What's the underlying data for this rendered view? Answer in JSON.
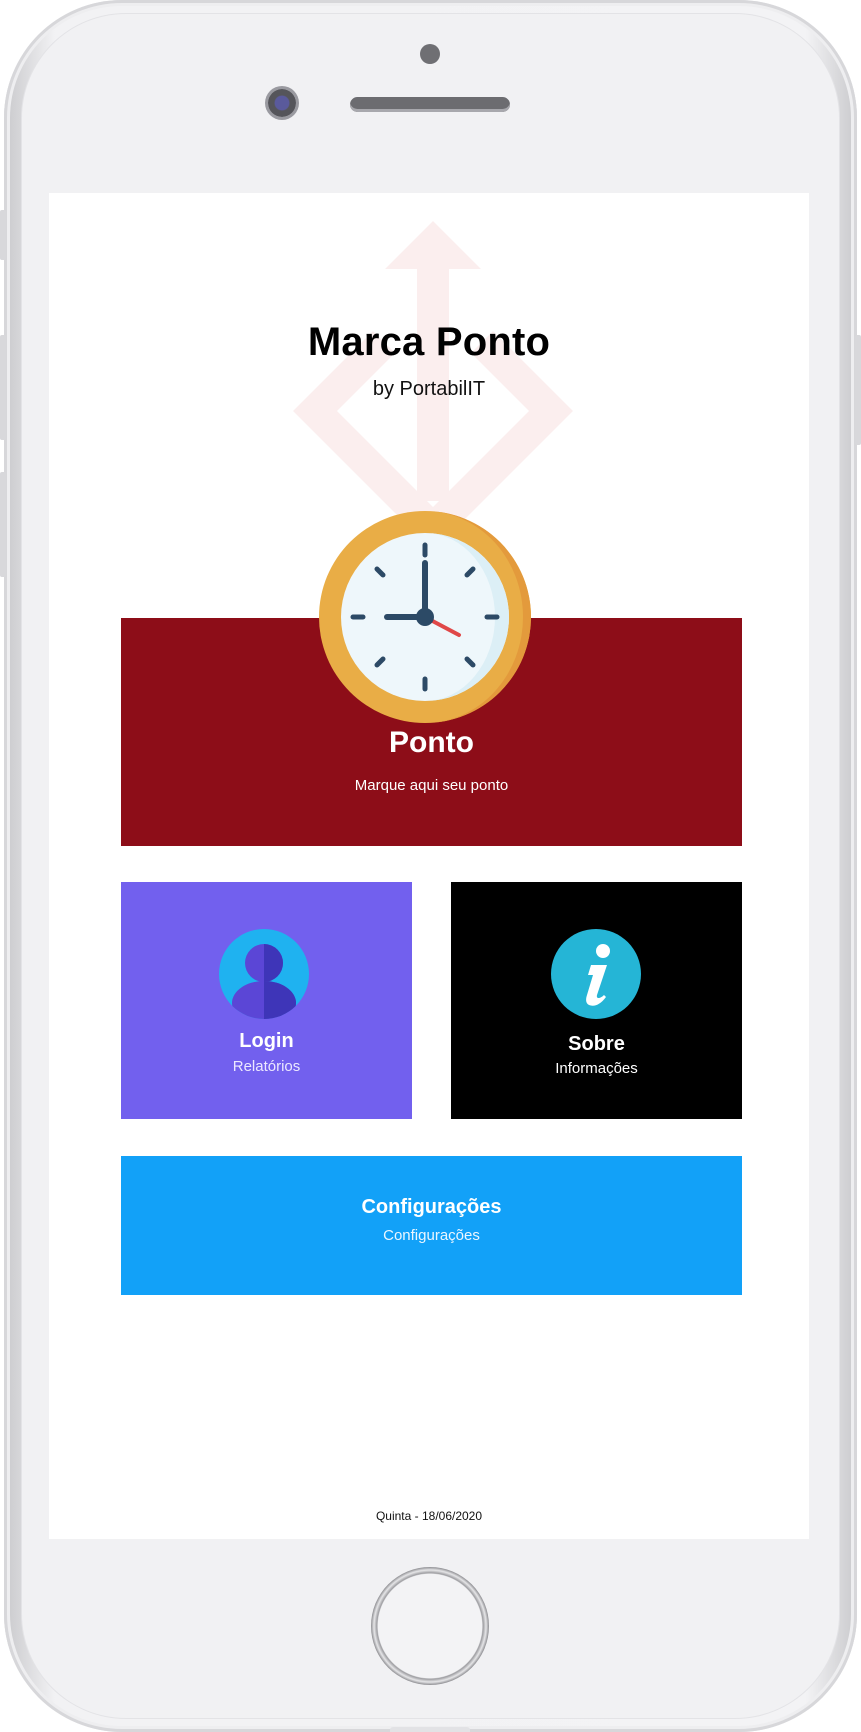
{
  "app": {
    "title": "Marca Ponto",
    "subtitle": "by PortabilIT"
  },
  "tiles": {
    "ponto": {
      "title": "Ponto",
      "subtitle": "Marque aqui seu ponto",
      "icon": "clock-icon",
      "color": "#8d0d18"
    },
    "login": {
      "title": "Login",
      "subtitle": "Relatórios",
      "icon": "user-icon",
      "color": "#7260ee"
    },
    "sobre": {
      "title": "Sobre",
      "subtitle": "Informações",
      "icon": "info-icon",
      "color": "#000000"
    },
    "config": {
      "title": "Configurações",
      "subtitle": "Configurações",
      "color": "#12a1f8"
    }
  },
  "footer": {
    "date": "Quinta - 18/06/2020"
  },
  "colors": {
    "clock_rim": "#e9ad46",
    "clock_face": "#eef7fb",
    "clock_hands": "#2c4a66",
    "clock_second_hand": "#e04848",
    "info_circle": "#25b5d6",
    "user_circle": "#1fb2f0"
  }
}
